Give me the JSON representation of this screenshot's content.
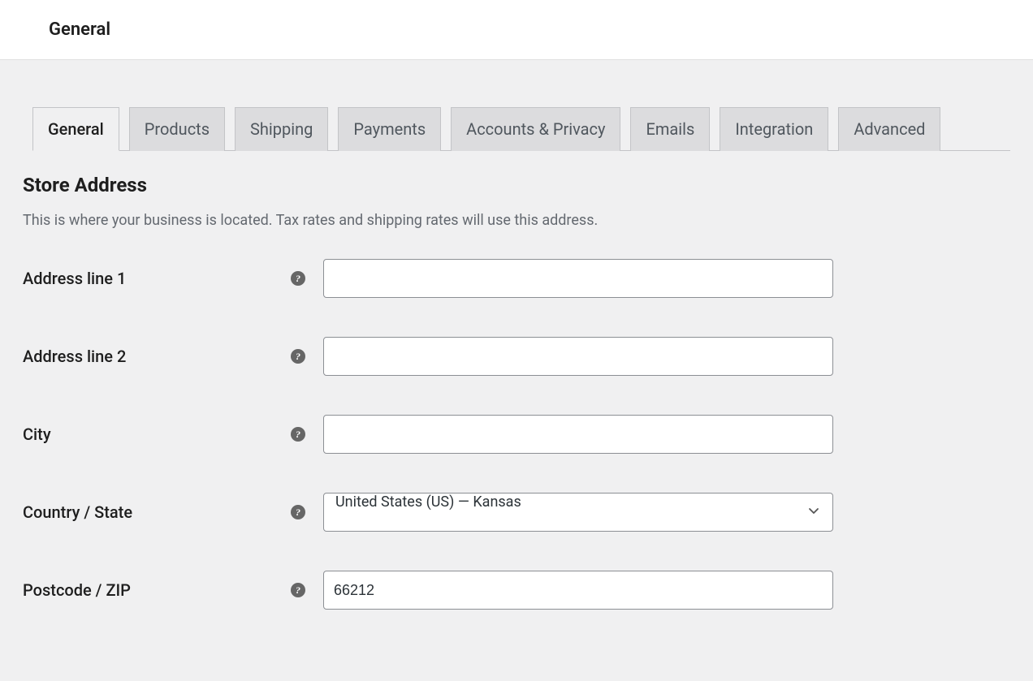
{
  "header": {
    "title": "General"
  },
  "tabs": {
    "items": [
      {
        "label": "General",
        "active": true
      },
      {
        "label": "Products",
        "active": false
      },
      {
        "label": "Shipping",
        "active": false
      },
      {
        "label": "Payments",
        "active": false
      },
      {
        "label": "Accounts & Privacy",
        "active": false
      },
      {
        "label": "Emails",
        "active": false
      },
      {
        "label": "Integration",
        "active": false
      },
      {
        "label": "Advanced",
        "active": false
      }
    ]
  },
  "section": {
    "title": "Store Address",
    "description": "This is where your business is located. Tax rates and shipping rates will use this address."
  },
  "form": {
    "address1": {
      "label": "Address line 1",
      "value": ""
    },
    "address2": {
      "label": "Address line 2",
      "value": ""
    },
    "city": {
      "label": "City",
      "value": ""
    },
    "country_state": {
      "label": "Country / State",
      "value": "United States (US) — Kansas"
    },
    "postcode": {
      "label": "Postcode / ZIP",
      "value": "66212"
    }
  }
}
